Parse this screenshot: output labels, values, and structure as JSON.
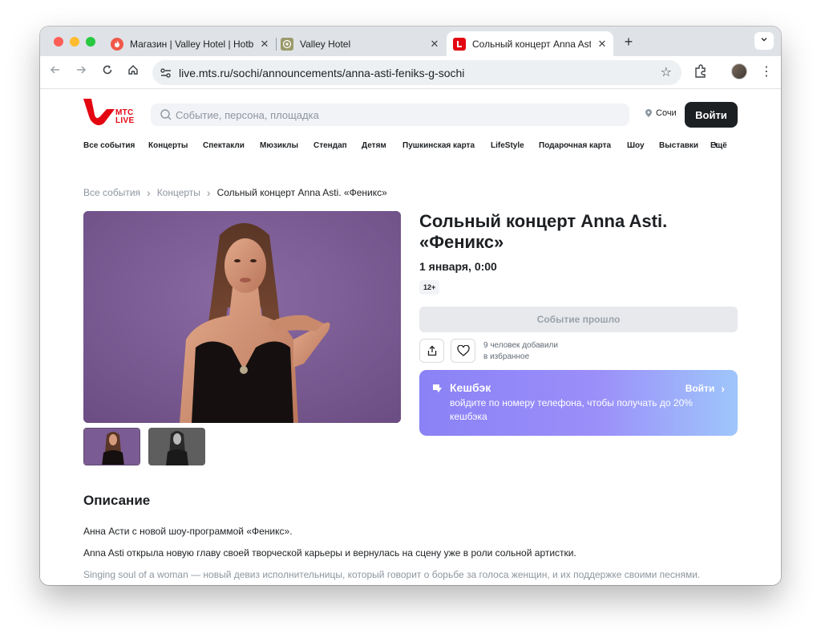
{
  "browser": {
    "tabs": [
      {
        "title": "Магазин | Valley Hotel | Hotbo",
        "active": false
      },
      {
        "title": "Valley Hotel",
        "active": false
      },
      {
        "title": "Сольный концерт Anna Asti",
        "active": true
      }
    ],
    "new_tab": "+",
    "close_glyph": "✕",
    "address": "live.mts.ru/sochi/announcements/anna-asti-feniks-g-sochi"
  },
  "site": {
    "logo": {
      "line1": "МТС",
      "line2": "LIVE"
    },
    "search_placeholder": "Событие, персона, площадка",
    "city": "Сочи",
    "login": "Войти",
    "nav": [
      "Все события",
      "Концерты",
      "Спектакли",
      "Мюзиклы",
      "Стендап",
      "Детям",
      "Пушкинская карта",
      "LifeStyle",
      "Подарочная карта",
      "Шоу",
      "Выставки",
      "Ещё"
    ]
  },
  "breadcrumbs": [
    "Все события",
    "Концерты",
    "Сольный концерт Anna Asti. «Феникс»"
  ],
  "event": {
    "title": "Сольный концерт Anna Asti. «Феникс»",
    "date": "1 января, 0:00",
    "age": "12+",
    "status_button": "Событие прошло",
    "favorites_line1": "9 человек добавили",
    "favorites_line2": "в избранное"
  },
  "cashback": {
    "title": "Кешбэк",
    "login": "Войти",
    "text": "войдите по номеру телефона, чтобы получать до 20% кешбэка"
  },
  "description": {
    "heading": "Описание",
    "paragraphs": [
      "Анна Асти с новой шоу-программой «Феникс».",
      "Anna Asti открыла новую главу своей творческой карьеры и вернулась на сцену уже в роли сольной артистки.",
      "Singing soul of a woman — новый девиз исполнительницы, который говорит о борьбе за голоса женщин, и их поддержке своими песнями."
    ]
  },
  "colors": {
    "brand_red": "#e30611",
    "dark": "#1d2023",
    "cashback_from": "#8a82f6",
    "cashback_to": "#9fc6fb"
  }
}
